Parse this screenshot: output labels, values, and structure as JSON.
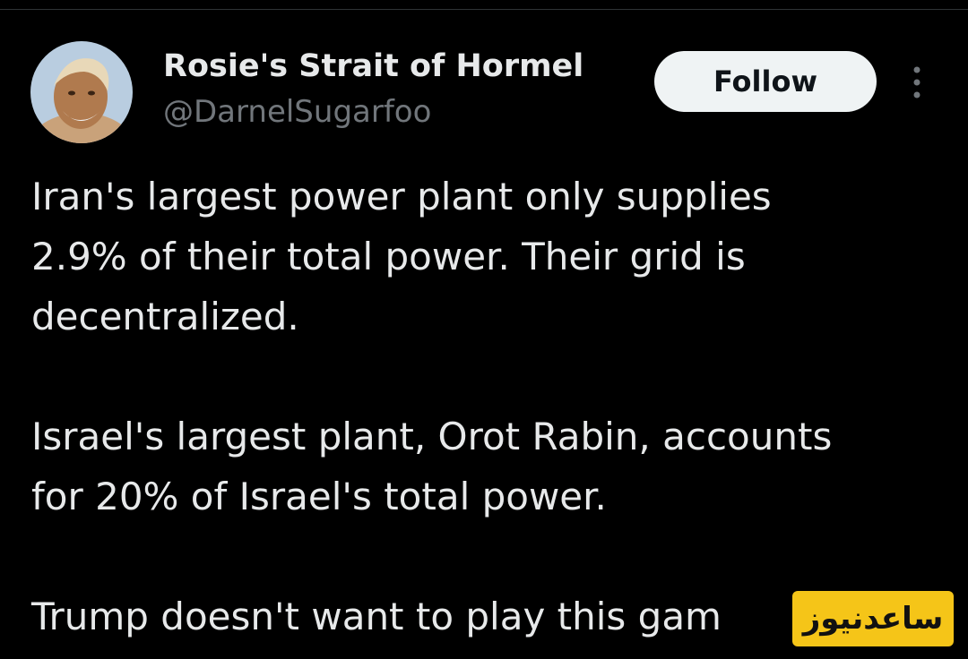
{
  "tweet": {
    "author": {
      "display_name": "Rosie's Strait of Hormel",
      "handle": "@DarnelSugarfoo",
      "avatar_icon": "avatar-photo"
    },
    "follow_label": "Follow",
    "more_icon": "more-vertical-icon",
    "paragraphs": [
      "Iran's largest power plant only supplies\n2.9% of their total power. Their grid is\ndecentralized.",
      "Israel's largest plant, Orot Rabin, accounts\nfor 20% of Israel's total power.",
      "Trump doesn't want to play this gam"
    ]
  },
  "watermark": {
    "text": "ساعدنیوز"
  },
  "colors": {
    "background": "#000000",
    "text_primary": "#e7e9ea",
    "text_secondary": "#71767b",
    "follow_bg": "#eff3f4",
    "follow_text": "#0f1419",
    "watermark_bg": "#f5c518"
  }
}
